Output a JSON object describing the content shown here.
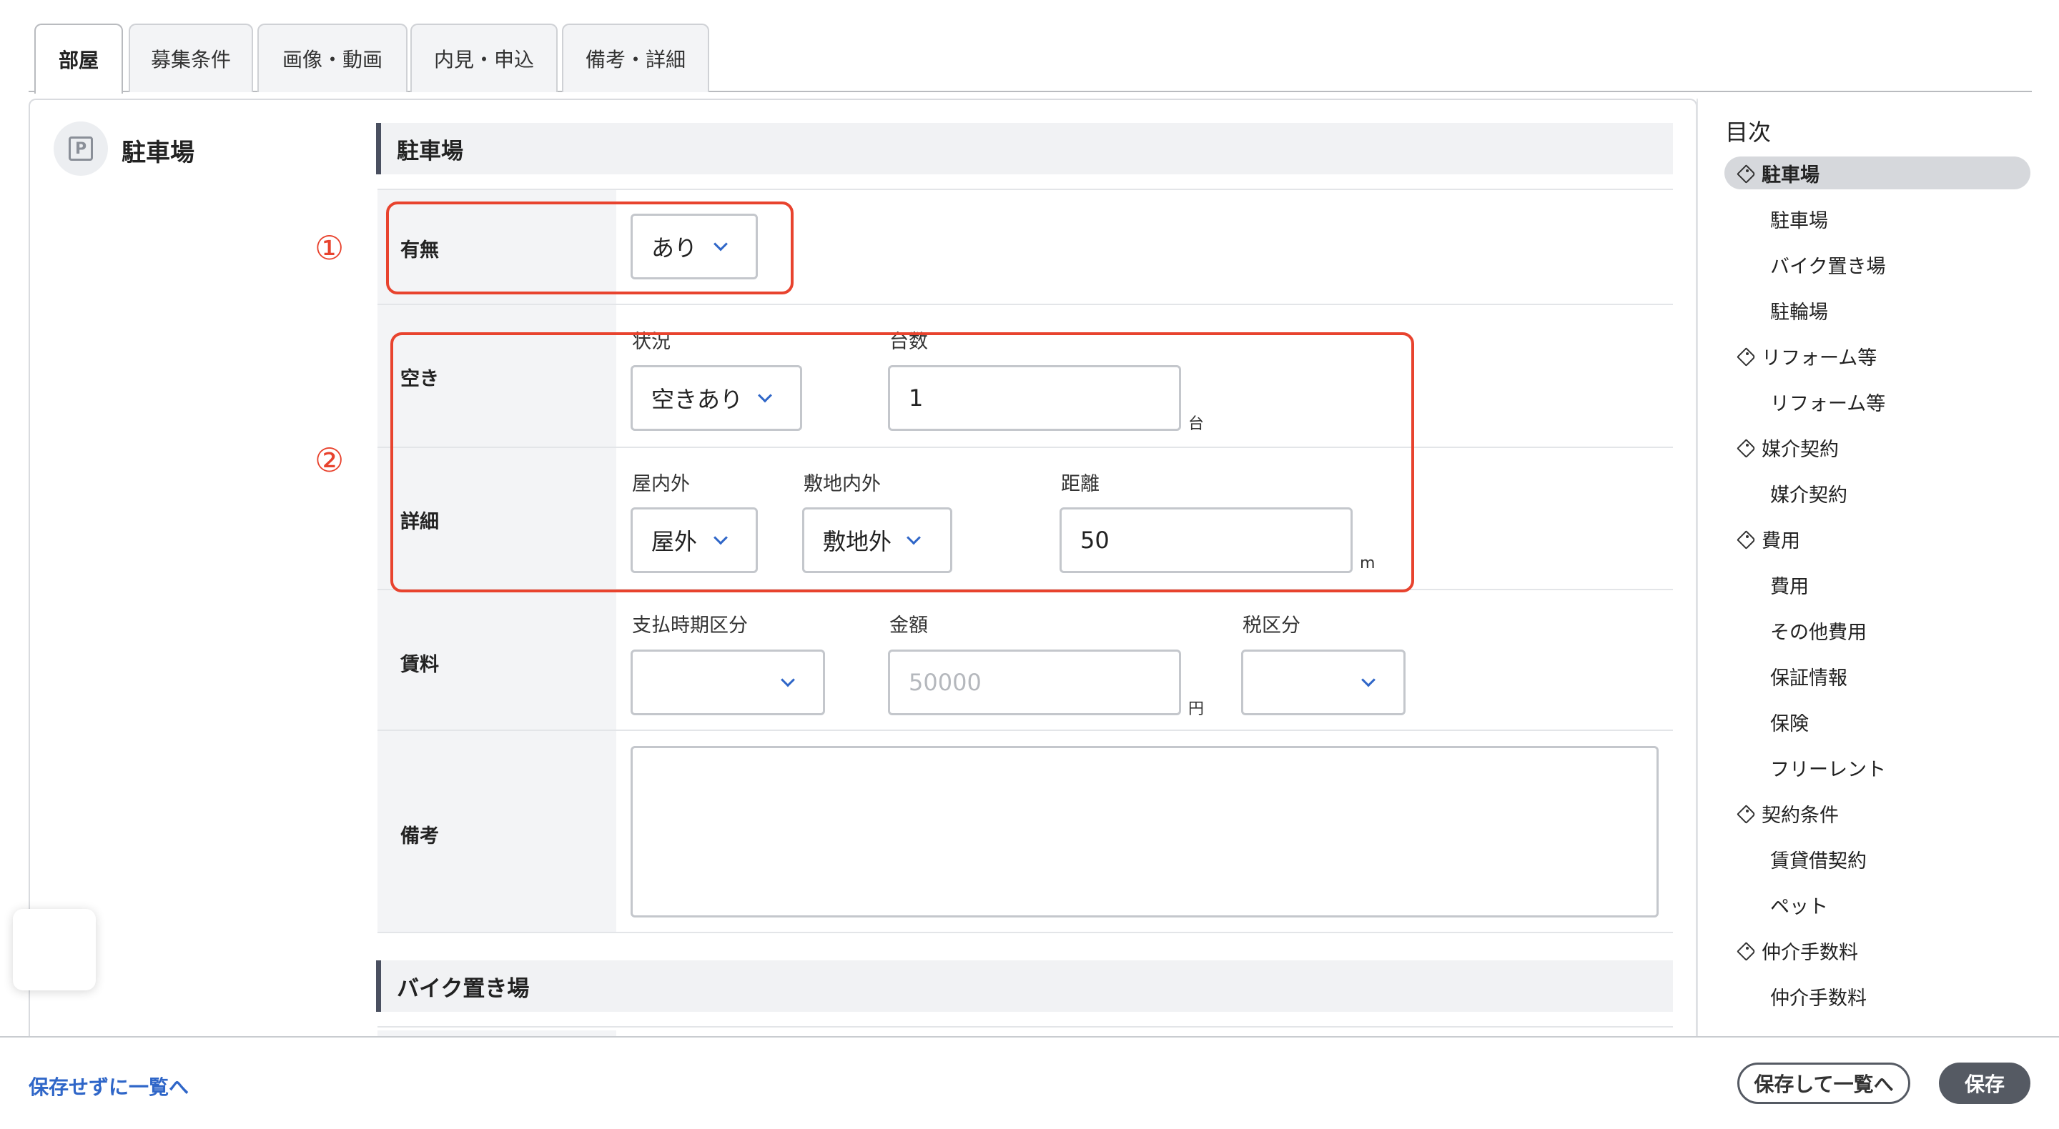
{
  "tabs": [
    {
      "label": "部屋",
      "active": true
    },
    {
      "label": "募集条件",
      "active": false
    },
    {
      "label": "画像・動画",
      "active": false
    },
    {
      "label": "内見・申込",
      "active": false
    },
    {
      "label": "備考・詳細",
      "active": false
    }
  ],
  "side_heading": {
    "icon": "parking-icon",
    "icon_letter": "P",
    "title": "駐車場"
  },
  "section": {
    "title": "駐車場"
  },
  "annotations": {
    "one": "①",
    "two": "②",
    "color": "#e8432e"
  },
  "rows": {
    "availability": {
      "label": "有無",
      "select_value": "あり"
    },
    "vacancy": {
      "label": "空き",
      "status_caption": "状況",
      "status_value": "空きあり",
      "count_caption": "台数",
      "count_value": "1",
      "count_unit": "台"
    },
    "details": {
      "label": "詳細",
      "indoor_caption": "屋内外",
      "indoor_value": "屋外",
      "site_caption": "敷地内外",
      "site_value": "敷地外",
      "distance_caption": "距離",
      "distance_value": "50",
      "distance_unit": "m"
    },
    "fee": {
      "label": "賃料",
      "timing_caption": "支払時期区分",
      "timing_value": "",
      "amount_caption": "金額",
      "amount_placeholder": "50000",
      "amount_unit": "円",
      "tax_caption": "税区分",
      "tax_value": ""
    },
    "notes": {
      "label": "備考",
      "value": ""
    }
  },
  "next_section": {
    "title": "バイク置き場"
  },
  "toc": {
    "title": "目次",
    "items": [
      {
        "label": "駐車場",
        "type": "group",
        "active": true
      },
      {
        "label": "駐車場",
        "type": "sub"
      },
      {
        "label": "バイク置き場",
        "type": "sub"
      },
      {
        "label": "駐輪場",
        "type": "sub"
      },
      {
        "label": "リフォーム等",
        "type": "group"
      },
      {
        "label": "リフォーム等",
        "type": "sub"
      },
      {
        "label": "媒介契約",
        "type": "group"
      },
      {
        "label": "媒介契約",
        "type": "sub"
      },
      {
        "label": "費用",
        "type": "group"
      },
      {
        "label": "費用",
        "type": "sub"
      },
      {
        "label": "その他費用",
        "type": "sub"
      },
      {
        "label": "保証情報",
        "type": "sub"
      },
      {
        "label": "保険",
        "type": "sub"
      },
      {
        "label": "フリーレント",
        "type": "sub"
      },
      {
        "label": "契約条件",
        "type": "group"
      },
      {
        "label": "賃貸借契約",
        "type": "sub"
      },
      {
        "label": "ペット",
        "type": "sub"
      },
      {
        "label": "仲介手数料",
        "type": "group"
      },
      {
        "label": "仲介手数料",
        "type": "sub"
      }
    ]
  },
  "footer": {
    "back_link": "保存せずに一覧へ",
    "save_and_list": "保存して一覧へ",
    "save": "保存"
  },
  "colors": {
    "accent": "#2f66c8",
    "annotation": "#e8432e",
    "dark_button": "#555a63"
  }
}
